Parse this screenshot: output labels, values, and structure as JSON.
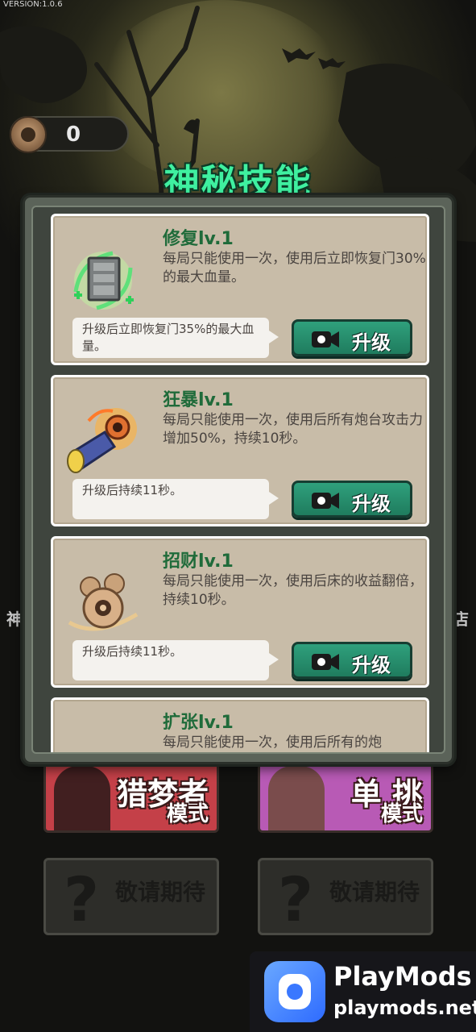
{
  "version": "VERSION:1.0.6",
  "coins": "0",
  "title": "神秘技能",
  "skills": [
    {
      "name": "修复lv.1",
      "desc": "每局只能使用一次，使用后立即恢复门30%的最大血量。",
      "upgrade_text": "升级后立即恢复门35%的最大血量。",
      "button": "升级",
      "icon": "door-repair-icon"
    },
    {
      "name": "狂暴lv.1",
      "desc": "每局只能使用一次，使用后所有炮台攻击力增加50%，持续10秒。",
      "upgrade_text": "升级后持续11秒。",
      "button": "升级",
      "icon": "cannon-rage-icon"
    },
    {
      "name": "招财lv.1",
      "desc": "每局只能使用一次，使用后床的收益翻倍，持续10秒。",
      "upgrade_text": "升级后持续11秒。",
      "button": "升级",
      "icon": "coin-fortune-icon"
    },
    {
      "name": "扩张lv.1",
      "desc": "每局只能使用一次，使用后所有的炮",
      "icon": "expand-card-icon"
    }
  ],
  "background": {
    "side_left": "神",
    "side_right": "店",
    "mode_left": {
      "big": "猎梦者",
      "small": "模式"
    },
    "mode_right": {
      "big": "单 挑",
      "small": "模式"
    },
    "coming_soon": "敬请期待"
  },
  "banner": {
    "name": "PlayMods",
    "url": "playmods.net"
  },
  "colors": {
    "title_green": "#3ff0a0",
    "skill_name_green": "#1f6b3a",
    "button_green": "#2fa07c",
    "card_bg": "#c8bca8"
  }
}
